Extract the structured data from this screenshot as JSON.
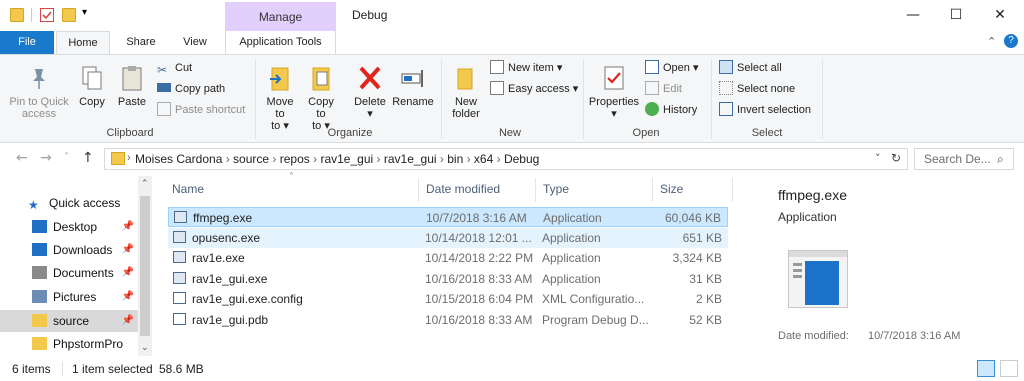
{
  "titlebar": {
    "context_tab": "Manage",
    "window_title": "Debug",
    "minimize": "—",
    "maximize": "☐",
    "close": "✕"
  },
  "tabs": {
    "file": "File",
    "home": "Home",
    "share": "Share",
    "view": "View",
    "app_tools": "Application Tools"
  },
  "ribbon": {
    "clipboard": {
      "label": "Clipboard",
      "pin": "Pin to Quick access",
      "copy": "Copy",
      "paste": "Paste",
      "cut": "Cut",
      "copy_path": "Copy path",
      "paste_shortcut": "Paste shortcut"
    },
    "organize": {
      "label": "Organize",
      "move_to": "Move to",
      "copy_to": "Copy to",
      "delete": "Delete",
      "rename": "Rename"
    },
    "new": {
      "label": "New",
      "new_folder": "New folder",
      "new_item": "New item",
      "easy_access": "Easy access"
    },
    "open": {
      "label": "Open",
      "properties": "Properties",
      "open": "Open",
      "edit": "Edit",
      "history": "History"
    },
    "select": {
      "label": "Select",
      "select_all": "Select all",
      "select_none": "Select none",
      "invert": "Invert selection"
    }
  },
  "address": {
    "crumbs": [
      "Moises Cardona",
      "source",
      "repos",
      "rav1e_gui",
      "rav1e_gui",
      "bin",
      "x64",
      "Debug"
    ],
    "search_placeholder": "Search De..."
  },
  "nav": {
    "items": [
      {
        "label": "Quick access",
        "icon": "star-icon"
      },
      {
        "label": "Desktop",
        "icon": "desktop-icon"
      },
      {
        "label": "Downloads",
        "icon": "download-icon"
      },
      {
        "label": "Documents",
        "icon": "documents-icon"
      },
      {
        "label": "Pictures",
        "icon": "pictures-icon"
      },
      {
        "label": "source",
        "icon": "folder-icon"
      },
      {
        "label": "PhpstormPro",
        "icon": "folder-icon"
      }
    ]
  },
  "filelist": {
    "headers": {
      "name": "Name",
      "date": "Date modified",
      "type": "Type",
      "size": "Size"
    },
    "rows": [
      {
        "name": "ffmpeg.exe",
        "date": "10/7/2018 3:16 AM",
        "type": "Application",
        "size": "60,046 KB"
      },
      {
        "name": "opusenc.exe",
        "date": "10/14/2018 12:01 ...",
        "type": "Application",
        "size": "651 KB"
      },
      {
        "name": "rav1e.exe",
        "date": "10/14/2018 2:22 PM",
        "type": "Application",
        "size": "3,324 KB"
      },
      {
        "name": "rav1e_gui.exe",
        "date": "10/16/2018 8:33 AM",
        "type": "Application",
        "size": "31 KB"
      },
      {
        "name": "rav1e_gui.exe.config",
        "date": "10/15/2018 6:04 PM",
        "type": "XML Configuratio...",
        "size": "2 KB"
      },
      {
        "name": "rav1e_gui.pdb",
        "date": "10/16/2018 8:33 AM",
        "type": "Program Debug D...",
        "size": "52 KB"
      }
    ]
  },
  "preview": {
    "filename": "ffmpeg.exe",
    "filetype": "Application",
    "date_label": "Date modified:",
    "date_value": "10/7/2018 3:16 AM"
  },
  "status": {
    "count": "6 items",
    "selection": "1 item selected",
    "size": "58.6 MB"
  },
  "colors": {
    "accent": "#1979ca",
    "manage": "#e3cffb",
    "selection": "#cce8ff"
  }
}
